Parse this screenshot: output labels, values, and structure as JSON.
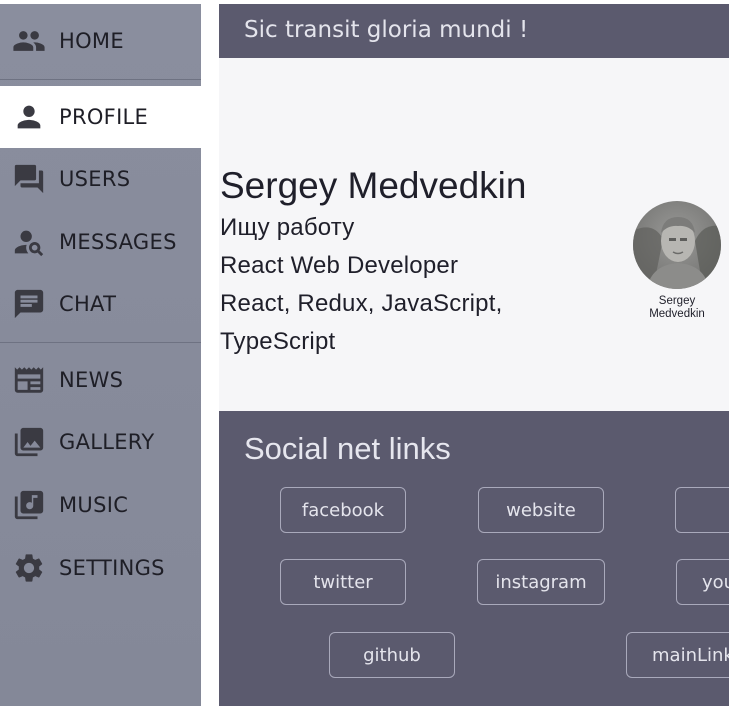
{
  "sidebar": {
    "items": [
      {
        "label": "HOME",
        "icon": "people-icon"
      },
      {
        "label": "PROFILE",
        "icon": "person-icon"
      },
      {
        "label": "USERS",
        "icon": "forum-icon"
      },
      {
        "label": "MESSAGES",
        "icon": "person-search-icon"
      },
      {
        "label": "CHAT",
        "icon": "chat-icon"
      },
      {
        "label": "NEWS",
        "icon": "newspaper-icon"
      },
      {
        "label": "GALLERY",
        "icon": "photo-library-icon"
      },
      {
        "label": "MUSIC",
        "icon": "music-library-icon"
      },
      {
        "label": "SETTINGS",
        "icon": "gear-icon"
      }
    ],
    "active": "PROFILE"
  },
  "header": {
    "title": "Sic transit gloria mundi !"
  },
  "profile": {
    "name": "Sergey Medvedkin",
    "lines": [
      "Ищу работу",
      "React Web Developer",
      "React, Redux, JavaScript,",
      "TypeScript"
    ],
    "avatar_caption_line1": "Sergey",
    "avatar_caption_line2": "Medvedkin"
  },
  "social": {
    "title": "Social net links",
    "links": [
      "facebook",
      "website",
      "",
      "twitter",
      "instagram",
      "you",
      "github",
      "mainLink"
    ]
  },
  "colors": {
    "sidebar_bg": "#8a8e9e",
    "header_bg": "#5b5a6e",
    "active_item_bg": "#ffffff",
    "button_border": "#a9a9bb"
  }
}
